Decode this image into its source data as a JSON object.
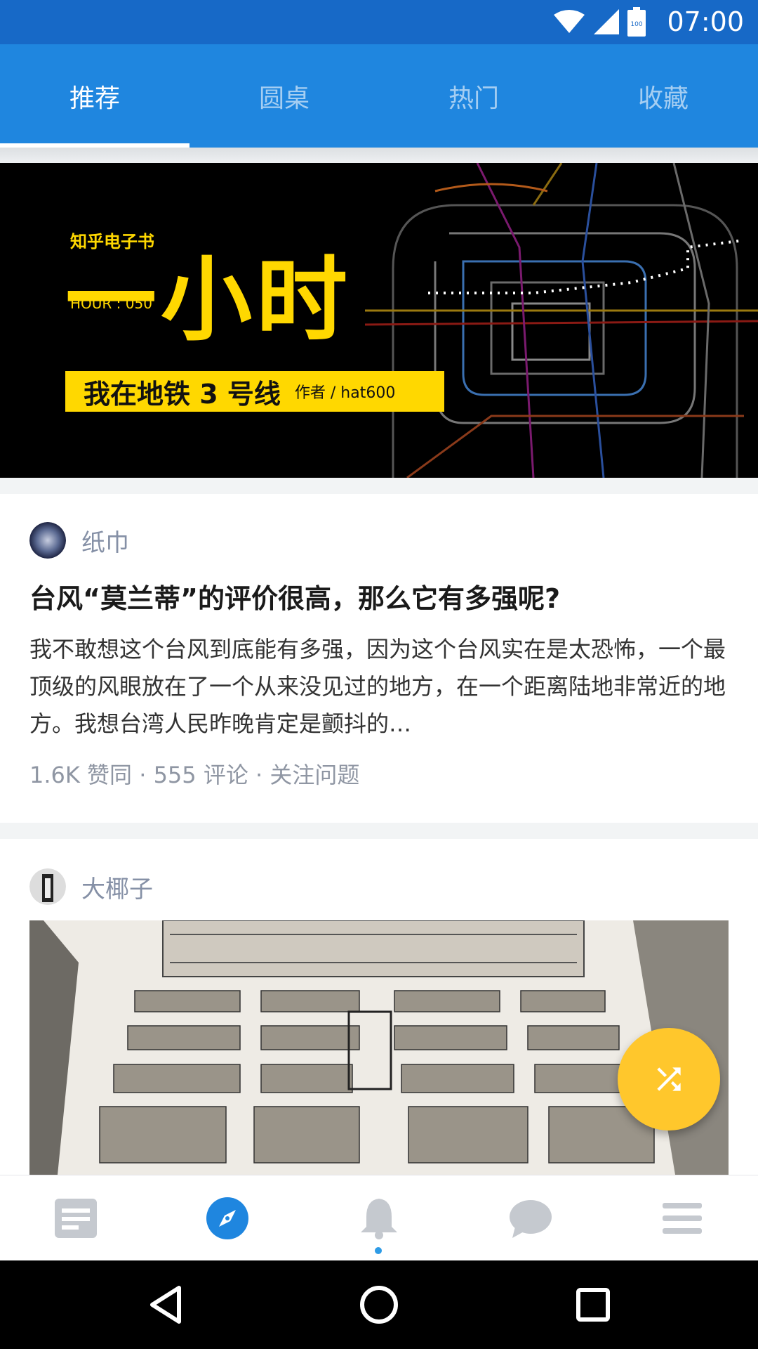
{
  "status_bar": {
    "time": "07:00",
    "battery": "100",
    "icons": [
      "wifi-icon",
      "signal-icon",
      "battery-icon"
    ]
  },
  "tabs": [
    {
      "label": "推荐",
      "active": true
    },
    {
      "label": "圆桌",
      "active": false
    },
    {
      "label": "热门",
      "active": false
    },
    {
      "label": "收藏",
      "active": false
    }
  ],
  "banner": {
    "brand": "知乎电子书",
    "headline": "一小时",
    "hour": "HOUR : 050",
    "subtitle": "我在地铁 3 号线",
    "author": "作者 / hat600"
  },
  "feed": [
    {
      "author": "纸巾",
      "title": "台风“莫兰蒂”的评价很高，那么它有多强呢?",
      "excerpt": "我不敢想这个台风到底能有多强，因为这个台风实在是太恐怖，一个最顶级的风眼放在了一个从来没见过的地方，在一个距离陆地非常近的地方。我想台湾人民昨晚肯定是颤抖的…",
      "meta": "1.6K 赞同 · 555 评论 · 关注问题"
    },
    {
      "author": "大椰子"
    }
  ],
  "bottom_nav": [
    "feed-icon",
    "explore-icon",
    "notification-icon",
    "message-icon",
    "menu-icon"
  ],
  "colors": {
    "primary": "#1f86df",
    "status": "#1769c7",
    "fab": "#ffc72c",
    "banner_yellow": "#ffd800"
  }
}
